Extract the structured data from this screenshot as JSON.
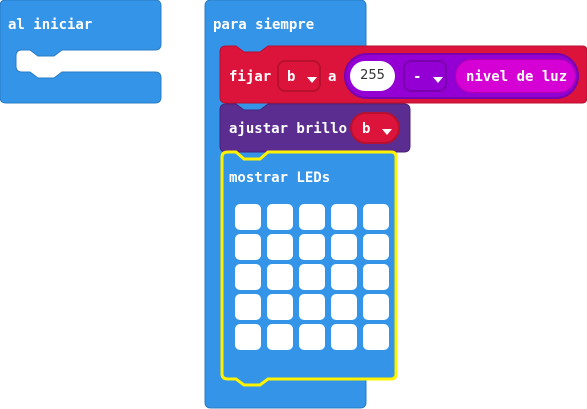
{
  "blocks": {
    "on_start": {
      "label": "al iniciar"
    },
    "forever": {
      "label": "para siempre"
    },
    "set_var": {
      "label": "fijar",
      "variable": "b",
      "to_label": "a",
      "number_value": "255",
      "operator": "-",
      "sensor_label": "nivel de luz"
    },
    "set_brightness": {
      "label": "ajustar brillo",
      "variable": "b"
    },
    "show_leds": {
      "label": "mostrar LEDs",
      "grid": [
        [
          0,
          0,
          0,
          0,
          0
        ],
        [
          0,
          0,
          0,
          0,
          0
        ],
        [
          0,
          0,
          0,
          0,
          0
        ],
        [
          0,
          0,
          0,
          0,
          0
        ],
        [
          0,
          0,
          0,
          0,
          0
        ]
      ]
    }
  },
  "colors": {
    "basic_blue": "#3394e8",
    "variables_red": "#dc143c",
    "math_purple": "#9400d3",
    "input_magenta": "#d400d4",
    "led_purple": "#5c2d91",
    "selection_yellow": "#fff200"
  }
}
